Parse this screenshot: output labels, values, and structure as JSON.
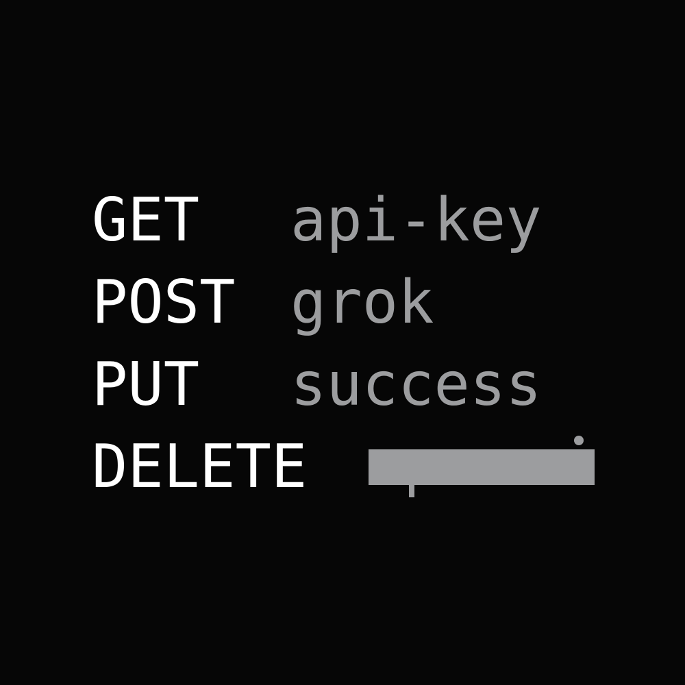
{
  "rows": [
    {
      "method": "GET",
      "value": "api-key"
    },
    {
      "method": "POST",
      "value": "grok"
    },
    {
      "method": "PUT",
      "value": "success"
    },
    {
      "method": "DELETE",
      "value": ""
    }
  ],
  "colors": {
    "background": "#060606",
    "method_text": "#ffffff",
    "value_text": "#9c9d9f",
    "redaction": "#9c9d9f"
  }
}
